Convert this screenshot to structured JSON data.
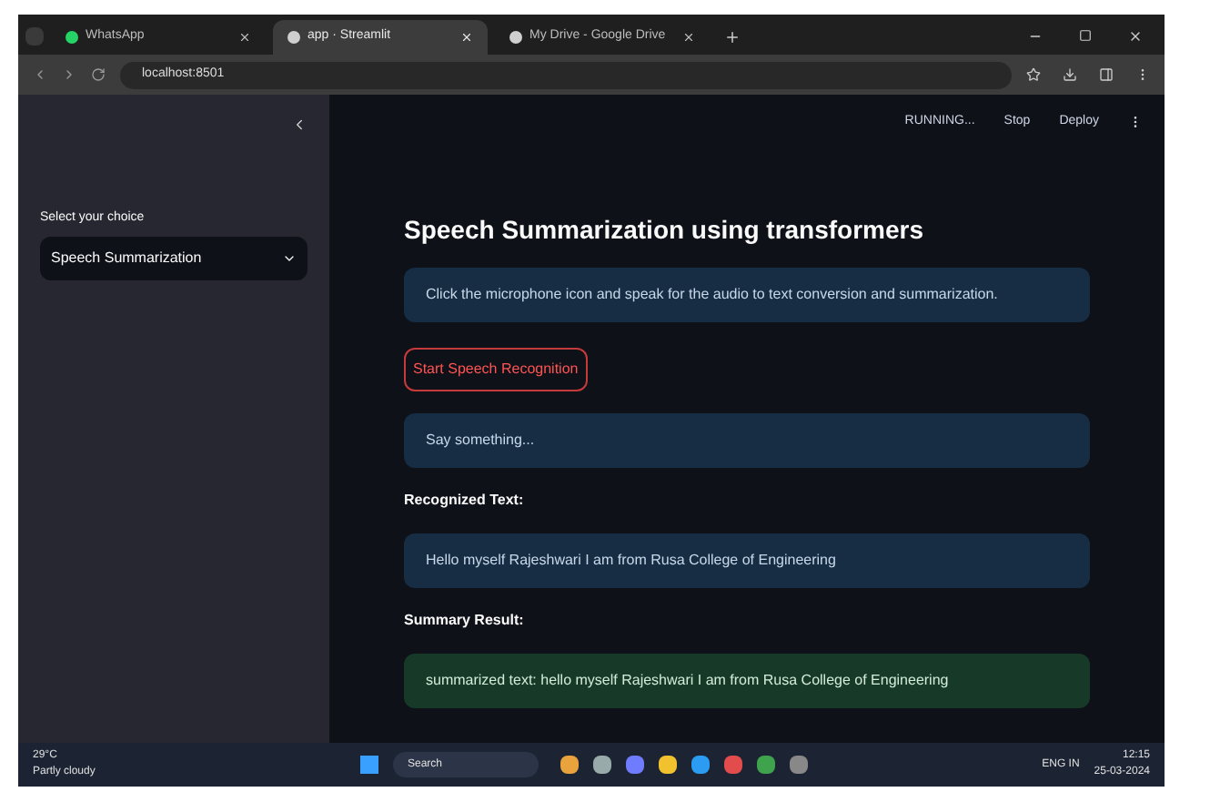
{
  "browser": {
    "tabs": [
      {
        "title": "WhatsApp",
        "selected": false
      },
      {
        "title": "app · Streamlit",
        "selected": true
      },
      {
        "title": "My Drive - Google Drive",
        "selected": false
      }
    ],
    "address": "localhost:8501"
  },
  "header": {
    "status": "RUNNING...",
    "stop": "Stop",
    "deploy": "Deploy"
  },
  "sidebar": {
    "label": "Select your choice",
    "select": {
      "value": "Speech Summarization"
    }
  },
  "main": {
    "title": "Speech Summarization using transformers",
    "blocks": [
      {
        "kind": "info",
        "text": "Click the microphone icon and speak for the audio to text conversion and summarization."
      },
      {
        "kind": "button",
        "text": "Start Speech Recognition"
      },
      {
        "kind": "info",
        "text": "Say something..."
      },
      {
        "kind": "label",
        "text": "Recognized Text:"
      },
      {
        "kind": "info",
        "text": "Hello myself Rajeshwari I am from Rusa College of Engineering"
      },
      {
        "kind": "label",
        "text": "Summary Result:"
      },
      {
        "kind": "success",
        "text": "summarized text: hello myself Rajeshwari I am from Rusa College of Engineering"
      }
    ]
  },
  "taskbar": {
    "weather": {
      "temp": "29°C",
      "condition": "Partly cloudy"
    },
    "search": "Search",
    "lang": "ENG IN",
    "time": "12:15",
    "date": "25-03-2024"
  }
}
